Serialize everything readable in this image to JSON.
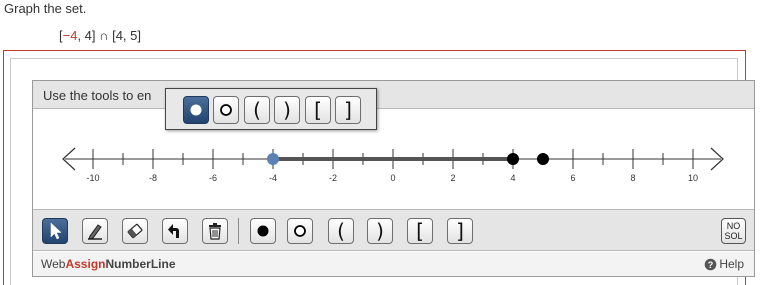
{
  "prompt": "Graph the set.",
  "expression": {
    "open": "[",
    "neg": "−4",
    "rest": ", 4] ∩ [4, 5]"
  },
  "widget": {
    "header_text": "Use the tools to en",
    "tick_labels": [
      "-10",
      "-8",
      "-6",
      "-4",
      "-2",
      "0",
      "2",
      "4",
      "6",
      "8",
      "10"
    ],
    "axis_min": -11,
    "axis_max": 11,
    "graph": {
      "segment_start": -4,
      "segment_end": 4,
      "points": [
        {
          "x": -4,
          "style": "blue-dot"
        },
        {
          "x": 4,
          "style": "filled"
        },
        {
          "x": 5,
          "style": "filled"
        }
      ]
    }
  },
  "toolbar": {
    "tools": [
      {
        "name": "pointer-tool",
        "icon": "arrow-cursor-icon"
      },
      {
        "name": "pencil-tool",
        "icon": "pencil-icon"
      },
      {
        "name": "eraser-tool",
        "icon": "eraser-icon"
      },
      {
        "name": "undo-tool",
        "icon": "undo-arrow-icon"
      },
      {
        "name": "trash-tool",
        "icon": "trash-icon"
      },
      {
        "name": "closed-dot-tool",
        "icon": "closed-dot-icon"
      },
      {
        "name": "open-dot-tool",
        "icon": "open-dot-icon"
      },
      {
        "name": "left-paren-tool",
        "label": "("
      },
      {
        "name": "right-paren-tool",
        "label": ")"
      },
      {
        "name": "left-bracket-tool",
        "label": "["
      },
      {
        "name": "right-bracket-tool",
        "label": "]"
      }
    ],
    "nosol_line1": "NO",
    "nosol_line2": "SOL"
  },
  "popup": {
    "left_paren": "(",
    "right_paren": ")",
    "left_bracket": "[",
    "right_bracket": "]"
  },
  "footer": {
    "brand_web": "Web",
    "brand_assign": "Assign",
    "brand_product": "NumberLine",
    "help_label": "Help"
  },
  "colors": {
    "accent_red": "#c0392b",
    "active_blue": "#2b4d78",
    "point_blue": "#5b82b3"
  }
}
